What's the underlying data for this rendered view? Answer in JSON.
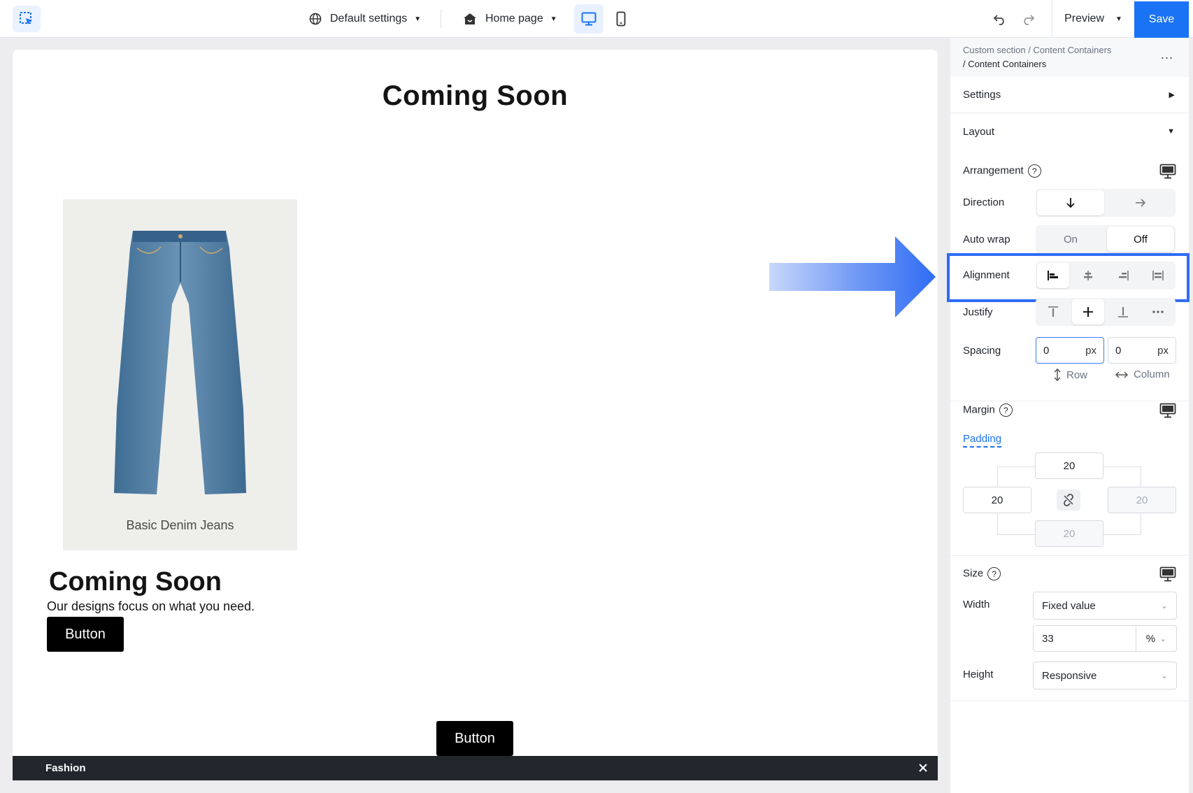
{
  "topbar": {
    "logo_icon": "selection-cursor-icon",
    "settings_label": "Default settings",
    "page_label": "Home page",
    "preview_label": "Preview",
    "save_label": "Save"
  },
  "canvas": {
    "title": "Coming Soon",
    "product_name": "Basic Denim Jeans",
    "title2": "Coming Soon",
    "description": "Our designs focus on what you need.",
    "button1": "Button",
    "button2": "Button",
    "footer_label": "Fashion"
  },
  "panel": {
    "breadcrumb_1": "Custom section / Content Containers",
    "breadcrumb_2": "/ Content Containers",
    "more": "...",
    "settings_label": "Settings",
    "layout_label": "Layout",
    "arrangement_label": "Arrangement",
    "direction_label": "Direction",
    "auto_wrap_label": "Auto wrap",
    "auto_wrap_on": "On",
    "auto_wrap_off": "Off",
    "alignment_label": "Alignment",
    "justify_label": "Justify",
    "spacing_label": "Spacing",
    "spacing_row_value": "0",
    "spacing_col_value": "0",
    "unit_px": "px",
    "row_label": "Row",
    "column_label": "Column",
    "margin_label": "Margin",
    "padding_label": "Padding",
    "padding_top": "20",
    "padding_left": "20",
    "padding_right": "20",
    "padding_bottom": "20",
    "size_label": "Size",
    "width_label": "Width",
    "width_mode": "Fixed value",
    "width_value": "33",
    "width_unit": "%",
    "height_label": "Height",
    "height_mode": "Responsive"
  },
  "colors": {
    "accent": "#1a73f5",
    "highlight_border": "#2f6cf5",
    "footer_bg": "#23262d"
  }
}
